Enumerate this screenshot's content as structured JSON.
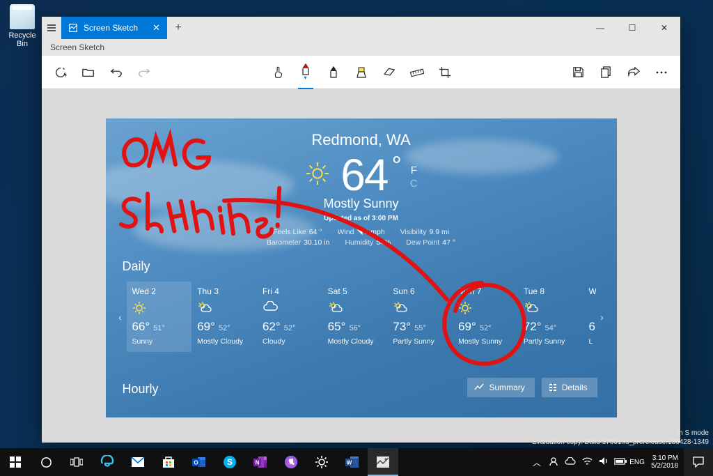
{
  "desktop": {
    "recycle_label": "Recycle Bin"
  },
  "window": {
    "tab_title": "Screen Sketch",
    "subtitle": "Screen Sketch",
    "controls": {
      "min": "—",
      "max": "☐",
      "close": "✕"
    }
  },
  "toolbar": {
    "left": [
      "new-sketch",
      "open",
      "undo",
      "redo"
    ],
    "center": [
      "touch-write",
      "pen-red",
      "pen-black",
      "highlighter",
      "eraser",
      "ruler",
      "crop"
    ],
    "right": [
      "save",
      "copy",
      "share",
      "more"
    ]
  },
  "weather": {
    "location": "Redmond, WA",
    "temp": "64",
    "unit_f": "F",
    "unit_c": "C",
    "condition": "Mostly Sunny",
    "updated": "Updated as of 3:00 PM",
    "stats": [
      {
        "label": "Feels Like",
        "value": "64 °"
      },
      {
        "label": "Wind",
        "value": "◥ 9 mph"
      },
      {
        "label": "Visibility",
        "value": "9.9 mi"
      },
      {
        "label": "Barometer",
        "value": "30.10 in"
      },
      {
        "label": "Humidity",
        "value": "54%"
      },
      {
        "label": "Dew Point",
        "value": "47 °"
      }
    ],
    "daily_label": "Daily",
    "hourly_label": "Hourly",
    "days": [
      {
        "name": "Wed 2",
        "icon": "sun",
        "hi": "66°",
        "lo": "51°",
        "cond": "Sunny",
        "active": true
      },
      {
        "name": "Thu 3",
        "icon": "pc",
        "hi": "69°",
        "lo": "52°",
        "cond": "Mostly Cloudy"
      },
      {
        "name": "Fri 4",
        "icon": "cl",
        "hi": "62°",
        "lo": "52°",
        "cond": "Cloudy"
      },
      {
        "name": "Sat 5",
        "icon": "pc",
        "hi": "65°",
        "lo": "56°",
        "cond": "Mostly Cloudy"
      },
      {
        "name": "Sun 6",
        "icon": "pc",
        "hi": "73°",
        "lo": "55°",
        "cond": "Partly Sunny"
      },
      {
        "name": "Mon 7",
        "icon": "sun",
        "hi": "69°",
        "lo": "52°",
        "cond": "Mostly Sunny"
      },
      {
        "name": "Tue 8",
        "icon": "pc",
        "hi": "72°",
        "lo": "54°",
        "cond": "Partly Sunny"
      },
      {
        "name": "W",
        "icon": "",
        "hi": "6",
        "lo": "",
        "cond": "L"
      }
    ],
    "summary_btn": "Summary",
    "details_btn": "Details",
    "annotation_text": "OMG Sunshine!"
  },
  "build": {
    "line1": "in S mode",
    "line2": "Evaluation copy. Build 17661.rs_prerelease.180428-1349"
  },
  "clock": {
    "time": "3:10 PM",
    "date": "5/2/2018"
  },
  "colors": {
    "accent": "#0078d7",
    "ink": "#e11212"
  }
}
